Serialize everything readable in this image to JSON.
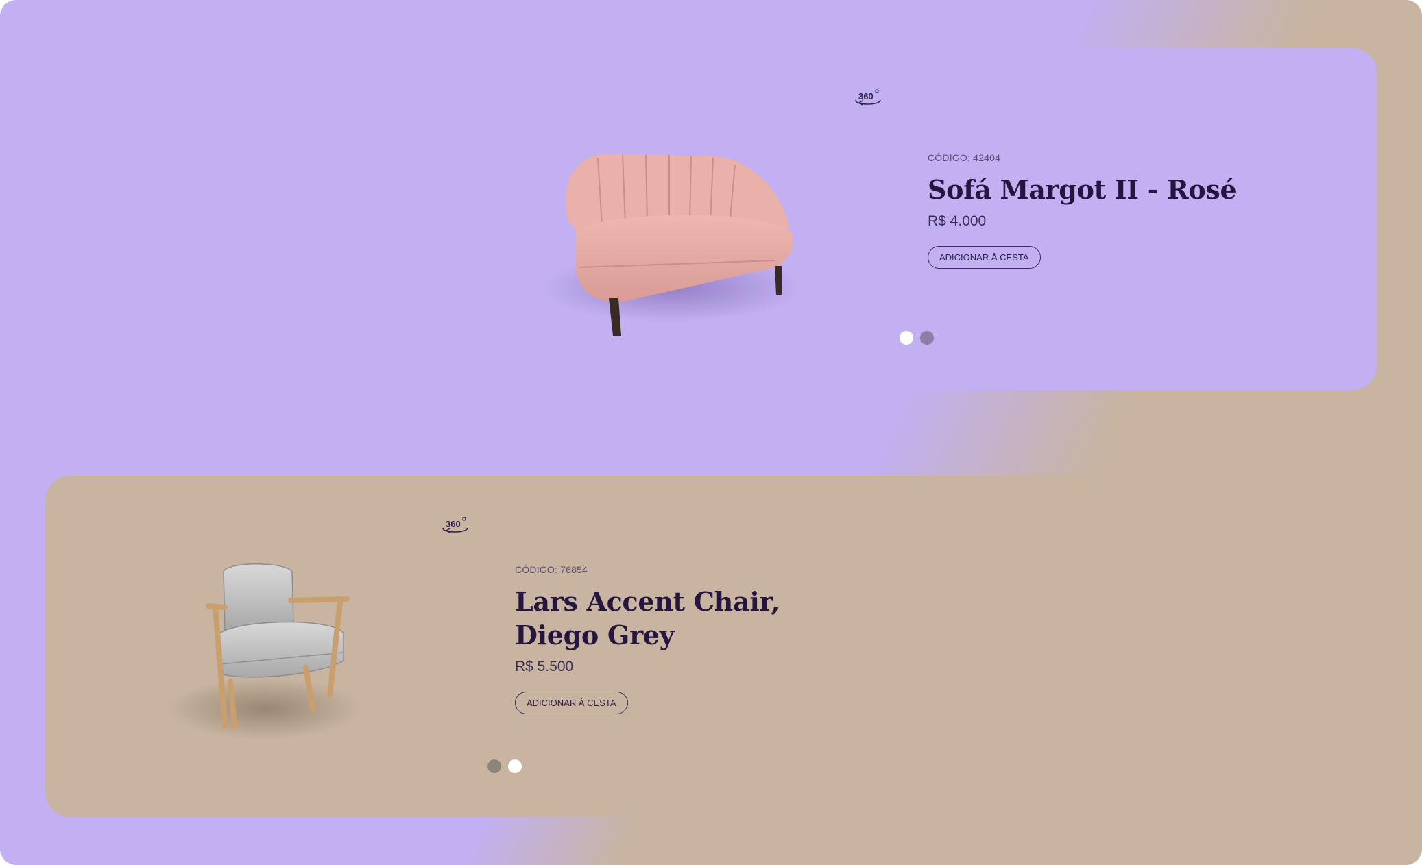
{
  "colors": {
    "lavender": "#c2b0f3",
    "beige": "#c8b4a0",
    "text_dark": "#24163f",
    "dot_active": "#ffffff",
    "dot_inactive_lavender": "#8c7ea6",
    "dot_inactive_beige": "#8e8578"
  },
  "products": [
    {
      "code_label": "CÓDIGO: 42404",
      "name": "Sofá Margot II - Rosé",
      "price": "R$ 4.000",
      "cta_label": "ADICIONAR À CESTA",
      "view_icon": "360-view-icon",
      "image": "pink-sofa",
      "slide_dots": [
        true,
        false
      ]
    },
    {
      "code_label": "CÓDIGO: 76854",
      "name_line1": "Lars Accent Chair,",
      "name_line2": "Diego Grey",
      "price": "R$ 5.500",
      "cta_label": "ADICIONAR À CESTA",
      "view_icon": "360-view-icon",
      "image": "grey-armchair",
      "slide_dots": [
        false,
        true
      ]
    }
  ]
}
